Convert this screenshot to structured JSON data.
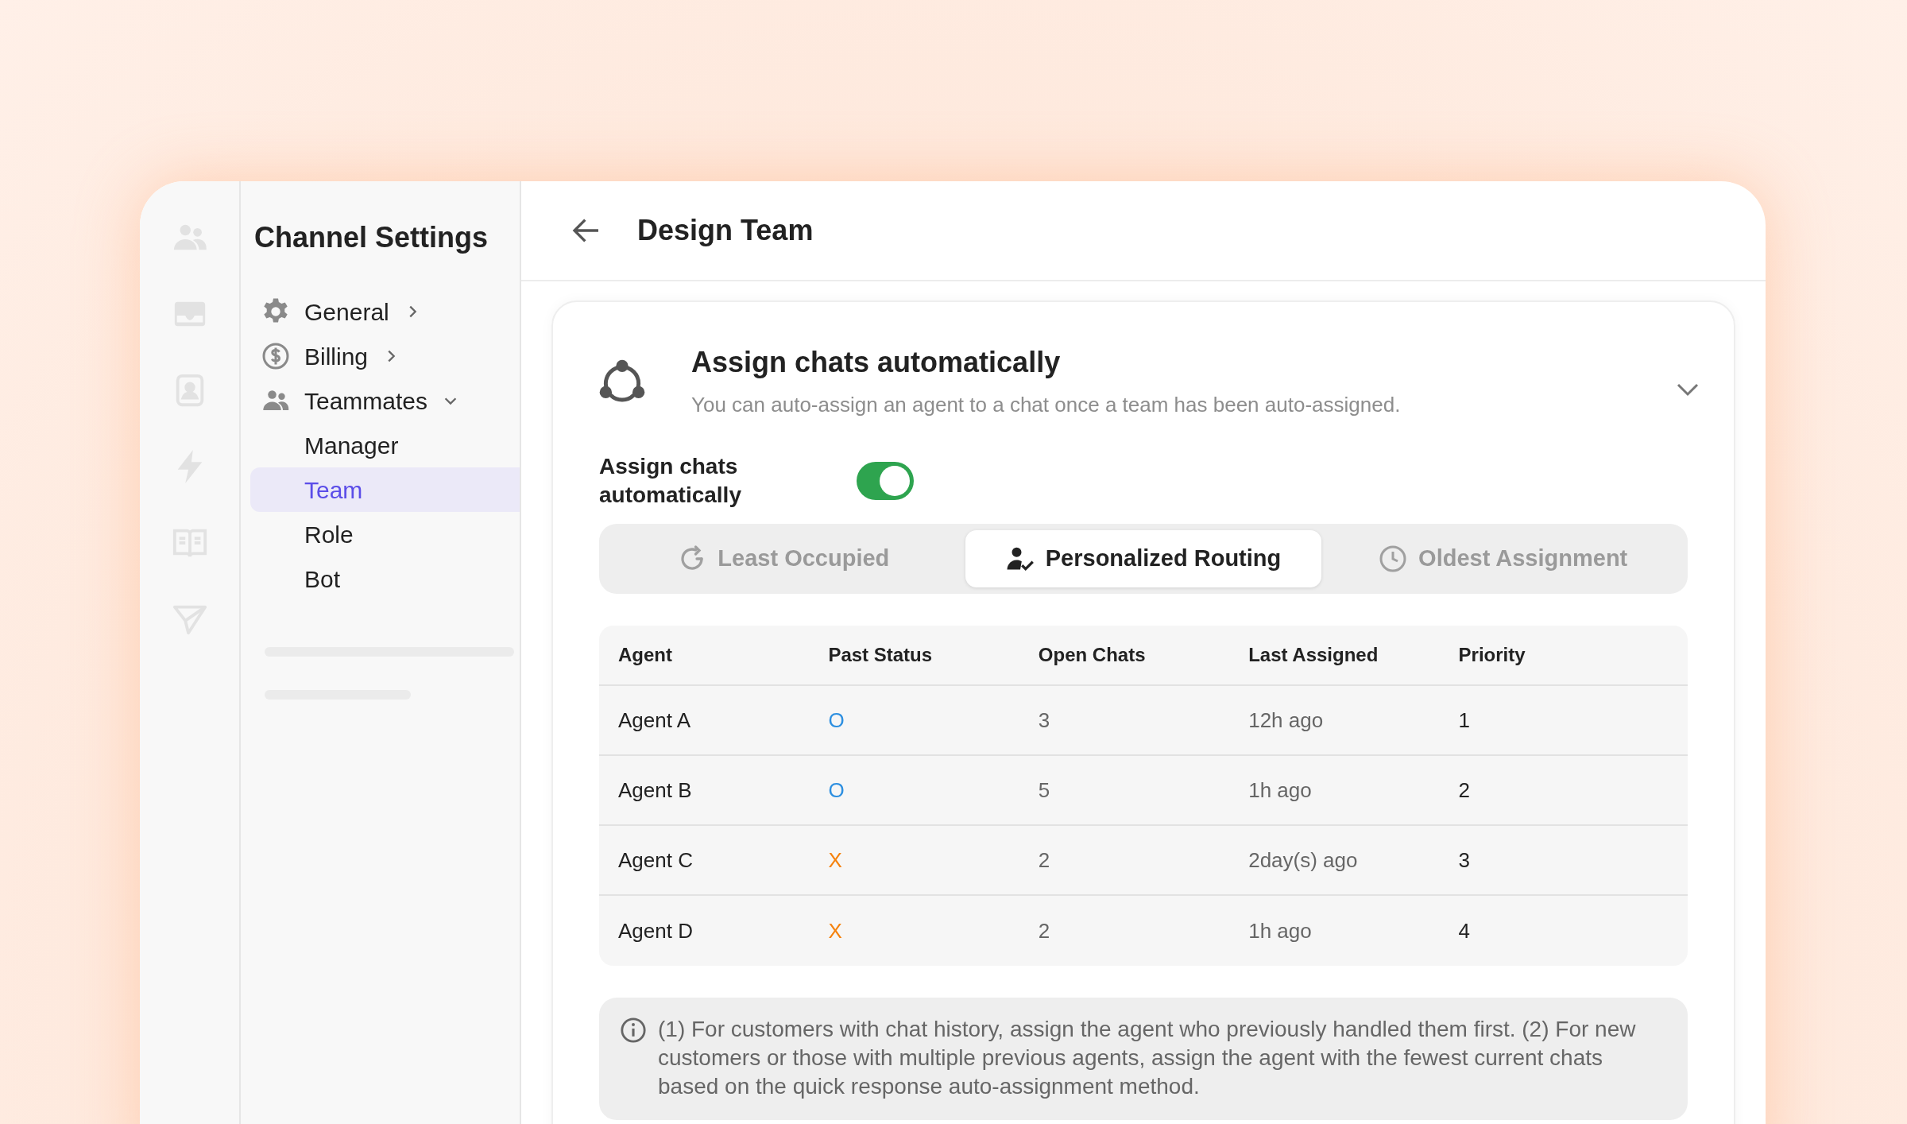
{
  "sidebar": {
    "title": "Channel Settings",
    "items": [
      {
        "label": "General",
        "expanded": false,
        "selected": false
      },
      {
        "label": "Billing",
        "expanded": false,
        "selected": false
      },
      {
        "label": "Teammates",
        "expanded": true,
        "selected": false,
        "children": [
          {
            "label": "Manager",
            "selected": false
          },
          {
            "label": "Team",
            "selected": true
          },
          {
            "label": "Role",
            "selected": false
          },
          {
            "label": "Bot",
            "selected": false
          }
        ]
      }
    ]
  },
  "header": {
    "title": "Design Team"
  },
  "card": {
    "title": "Assign chats automatically",
    "subtitle": "You can auto-assign an agent to a chat once a team has been auto-assigned.",
    "toggle": {
      "label": "Assign chats automatically",
      "on": true
    },
    "tabs": [
      {
        "label": "Least Occupied",
        "selected": false
      },
      {
        "label": "Personalized Routing",
        "selected": true
      },
      {
        "label": "Oldest Assignment",
        "selected": false
      }
    ],
    "table": {
      "columns": [
        "Agent",
        "Past Status",
        "Open Chats",
        "Last Assigned",
        "Priority"
      ],
      "rows": [
        {
          "agent": "Agent A",
          "status": {
            "text": "O",
            "color": "#2d8fe0"
          },
          "open_chats": "3",
          "last_assigned": "12h ago",
          "priority": "1"
        },
        {
          "agent": "Agent B",
          "status": {
            "text": "O",
            "color": "#2d8fe0"
          },
          "open_chats": "5",
          "last_assigned": "1h ago",
          "priority": "2"
        },
        {
          "agent": "Agent C",
          "status": {
            "text": "X",
            "color": "#f5820d"
          },
          "open_chats": "2",
          "last_assigned": "2day(s) ago",
          "priority": "3"
        },
        {
          "agent": "Agent D",
          "status": {
            "text": "X",
            "color": "#f5820d"
          },
          "open_chats": "2",
          "last_assigned": "1h ago",
          "priority": "4"
        }
      ]
    },
    "note": "(1) For customers with chat history, assign the agent who previously handled them first. (2) For new customers or those with multiple previous agents, assign the agent with the fewest current chats based on the quick response auto-assignment method."
  }
}
